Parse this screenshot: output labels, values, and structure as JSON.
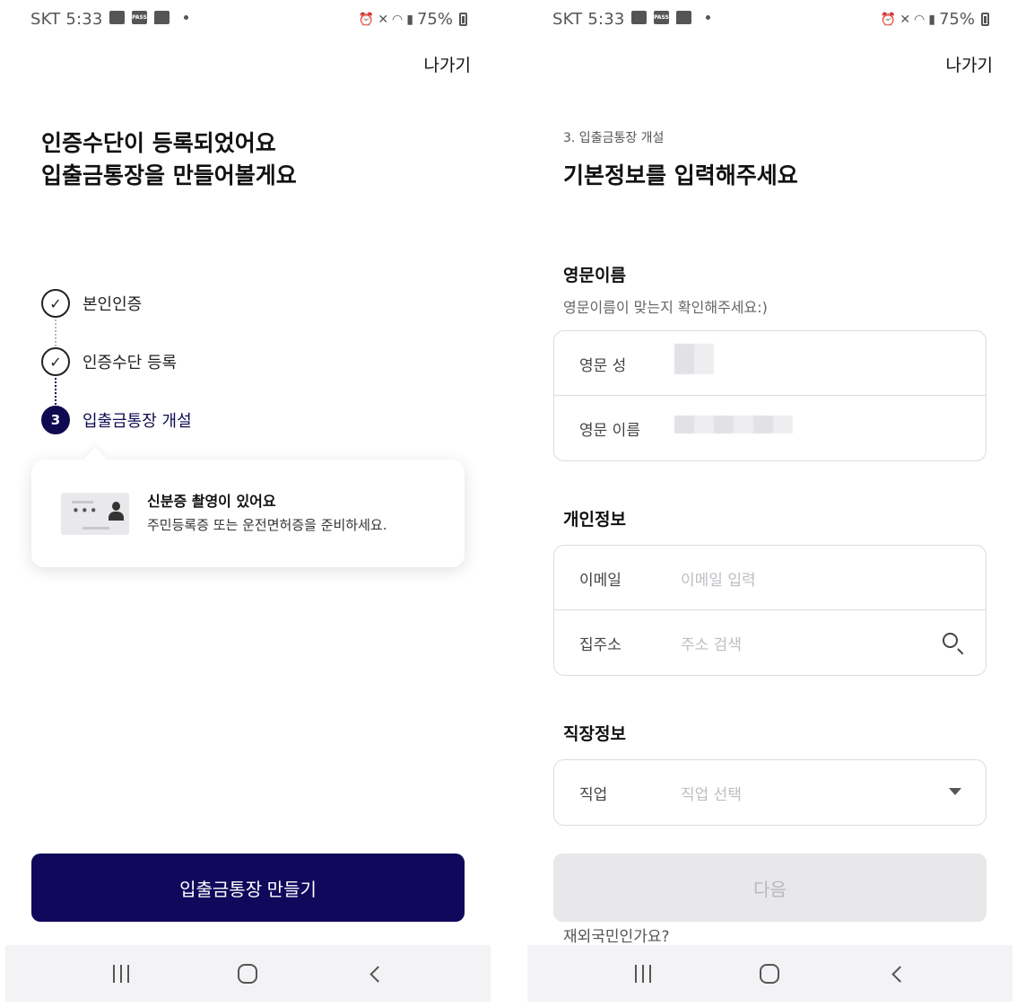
{
  "status_bar": {
    "carrier_time": "SKT 5:33",
    "battery": "75%"
  },
  "left": {
    "exit": "나가기",
    "headline_line1": "인증수단이 등록되었어요",
    "headline_line2": "입출금통장을 만들어볼게요",
    "steps": [
      {
        "label": "본인인증",
        "state": "done"
      },
      {
        "label": "인증수단 등록",
        "state": "done"
      },
      {
        "number": "3",
        "label": "입출금통장 개설",
        "state": "active"
      }
    ],
    "tooltip": {
      "title": "신분증 촬영이 있어요",
      "description": "주민등록증 또는 운전면허증을 준비하세요."
    },
    "primary_button": "입출금통장 만들기",
    "accent_color": "#10085a"
  },
  "right": {
    "exit": "나가기",
    "step_caption": "3. 입출금통장 개설",
    "title": "기본정보를 입력해주세요",
    "english_name": {
      "section_title": "영문이름",
      "subtitle": "영문이름이 맞는지 확인해주세요:)",
      "last_name_label": "영문 성",
      "first_name_label": "영문 이름"
    },
    "personal_info": {
      "section_title": "개인정보",
      "email_label": "이메일",
      "email_placeholder": "이메일 입력",
      "address_label": "집주소",
      "address_placeholder": "주소 검색"
    },
    "work_info": {
      "section_title": "직장정보",
      "job_label": "직업",
      "job_placeholder": "직업 선택"
    },
    "next_button": "다음",
    "overseas_link": "재외국민인가요?"
  }
}
